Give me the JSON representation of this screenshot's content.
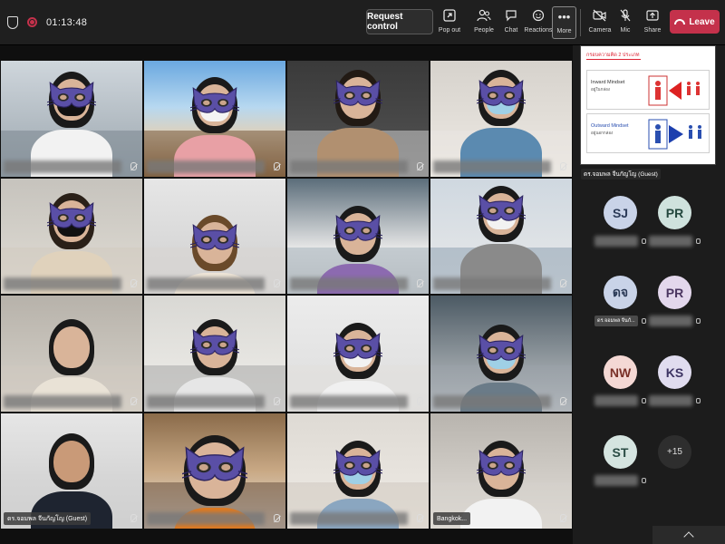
{
  "meeting": {
    "timer": "01:13:48",
    "request_control_label": "Request control"
  },
  "toolbar": {
    "items": [
      {
        "label": "Pop out",
        "icon": "popout-icon"
      },
      {
        "label": "People",
        "icon": "people-icon"
      },
      {
        "label": "Chat",
        "icon": "chat-icon"
      },
      {
        "label": "Reactions",
        "icon": "reactions-icon"
      },
      {
        "label": "More",
        "icon": "more-icon"
      },
      {
        "label": "Camera",
        "icon": "camera-icon"
      },
      {
        "label": "Mic",
        "icon": "mic-icon"
      },
      {
        "label": "Share",
        "icon": "share-icon"
      }
    ],
    "leave_label": "Leave"
  },
  "shared_content": {
    "slide_title": "กรอบความคิด 2 ประเภท",
    "box1_title": "Inward Mindset",
    "box1_sub": "อยู่ในกล่อง",
    "box2_title": "Outward Mindset",
    "box2_sub": "อยู่นอกกล่อง",
    "presenter": "ดร.จอมพล จีนกัญโญ (Guest)"
  },
  "tiles": [
    {
      "name": ""
    },
    {
      "name": ""
    },
    {
      "name": ""
    },
    {
      "name": ""
    },
    {
      "name": ""
    },
    {
      "name": ""
    },
    {
      "name": ""
    },
    {
      "name": ""
    },
    {
      "name": ""
    },
    {
      "name": ""
    },
    {
      "name": ""
    },
    {
      "name": ""
    },
    {
      "name": "ดร.จอมพล จีนกัญโญ (Guest)"
    },
    {
      "name": ""
    },
    {
      "name": ""
    },
    {
      "name": "Bangkok..."
    }
  ],
  "roster": [
    {
      "initials": "SJ",
      "color": "#c9d3e8",
      "text": "#2b3a57",
      "name": ""
    },
    {
      "initials": "PR",
      "color": "#cfe2dd",
      "text": "#23473d",
      "name": ""
    },
    {
      "initials": "ดจ",
      "color": "#c9d3e8",
      "text": "#2b3a57",
      "name": "ดร.จอมพล จีนกั..."
    },
    {
      "initials": "PR",
      "color": "#e3d7ec",
      "text": "#4a3560",
      "name": ""
    },
    {
      "initials": "NW",
      "color": "#f4d8d4",
      "text": "#7a3128",
      "name": ""
    },
    {
      "initials": "KS",
      "color": "#e0dcef",
      "text": "#3d3463",
      "name": ""
    },
    {
      "initials": "ST",
      "color": "#d5e4e0",
      "text": "#2a4b44",
      "name": ""
    }
  ],
  "more_count": "+15",
  "colors": {
    "leave": "#c4314b",
    "catmask": "#5a4fa6",
    "surgical_mask": "#9fd0e6"
  }
}
